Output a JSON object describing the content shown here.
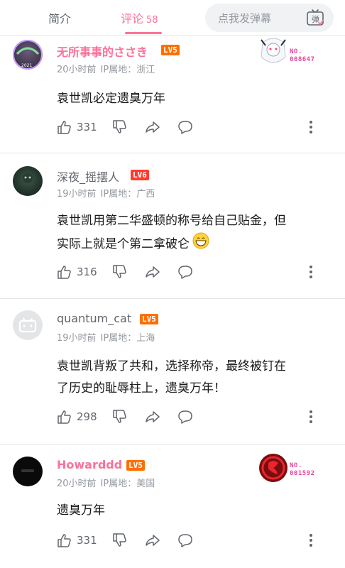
{
  "header": {
    "tabs": [
      {
        "label": "简介"
      },
      {
        "label": "评论",
        "count": "58"
      }
    ],
    "danmaku_placeholder": "点我发弹幕",
    "danmaku_button_label": "弹"
  },
  "comments": [
    {
      "username": "无所事事的ささき",
      "level": "LV5",
      "time": "20小时前",
      "ip": "IP属地：浙江",
      "content": "袁世凯必定遗臭万年",
      "likes": "331",
      "badge": {
        "no_label": "NO.",
        "no_value": "008647"
      },
      "avatar_text": "2021"
    },
    {
      "username": "深夜_摇摆人",
      "level": "LV6",
      "time": "19小时前",
      "ip": "IP属地：广西",
      "content_lines": [
        "袁世凯用第二华盛顿的称号给自己贴金，但",
        "实际上就是个第二拿破仑"
      ],
      "likes": "316"
    },
    {
      "username": "quantum_cat",
      "level": "LV5",
      "time": "19小时前",
      "ip": "IP属地：上海",
      "content_lines": [
        "袁世凯背叛了共和，选择称帝，最终被钉在",
        "了历史的耻辱柱上，遗臭万年！"
      ],
      "likes": "298"
    },
    {
      "username": "Howarddd",
      "level": "LV5",
      "time": "20小时前",
      "ip": "IP属地：美国",
      "content": "遗臭万年",
      "likes": "331",
      "badge": {
        "no_label": "NO.",
        "no_value": "001592"
      }
    }
  ],
  "icons": [
    "like-icon",
    "dislike-icon",
    "share-icon",
    "reply-icon",
    "more-icon",
    "danmaku-icon",
    "grin-emoji-icon"
  ],
  "colors": {
    "accent": "#fb7299",
    "level": "#ff6f00",
    "text_secondary": "#9499a0"
  }
}
